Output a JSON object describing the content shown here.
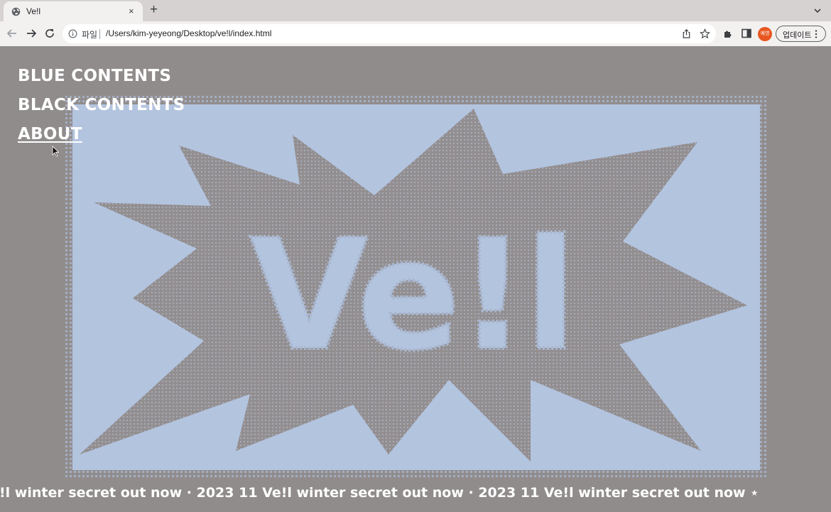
{
  "browser": {
    "tab": {
      "title": "Ve!l",
      "favicon": "globe-icon",
      "close_icon": "×"
    },
    "new_tab_icon": "+",
    "address": {
      "scheme_label": "파일",
      "url": "/Users/kim-yeyeong/Desktop/ve!l/index.html"
    },
    "profile_label": "예영",
    "update_button_label": "업데이트"
  },
  "page": {
    "menu": [
      {
        "label": "BLUE CONTENTS",
        "active": false
      },
      {
        "label": "BLACK CONTENTS",
        "active": false
      },
      {
        "label": "ABOUT",
        "active": true
      }
    ],
    "hero": {
      "wordmark": "Ve!l",
      "colors": {
        "background": "#918c8c",
        "panel": "#b3c4df",
        "burst": "#938e8f"
      }
    },
    "ticker": "!l winter secret out now ⋅ 2023 11 Ve!l winter secret out now ⋅ 2023 11 Ve!l winter secret out now ⋆"
  }
}
